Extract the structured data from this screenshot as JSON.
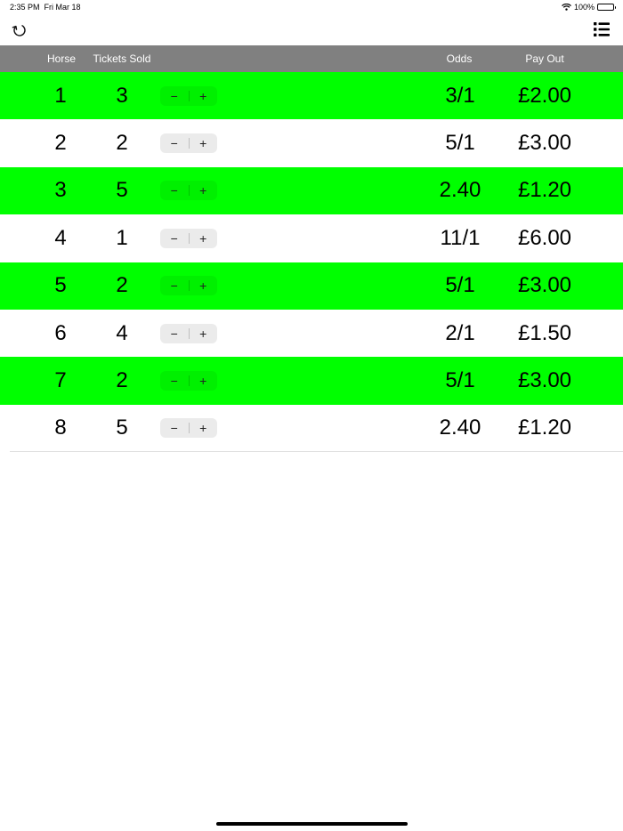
{
  "status_bar": {
    "time": "2:35 PM",
    "date": "Fri Mar 18",
    "battery_text": "100%",
    "wifi_icon": "wifi-icon",
    "battery_icon": "battery-icon"
  },
  "toolbar": {
    "refresh_icon": "refresh-icon",
    "list_icon": "list-icon"
  },
  "columns": {
    "horse": "Horse",
    "tickets_sold": "Tickets Sold",
    "odds": "Odds",
    "pay_out": "Pay Out"
  },
  "stepper": {
    "minus": "−",
    "plus": "+"
  },
  "colors": {
    "highlight": "#00ff00",
    "header_bg": "#808080",
    "plain_row": "#ffffff"
  },
  "rows": [
    {
      "horse": "1",
      "tickets": "3",
      "odds": "3/1",
      "payout": "£2.00",
      "highlight": true
    },
    {
      "horse": "2",
      "tickets": "2",
      "odds": "5/1",
      "payout": "£3.00",
      "highlight": false
    },
    {
      "horse": "3",
      "tickets": "5",
      "odds": "2.40",
      "payout": "£1.20",
      "highlight": true
    },
    {
      "horse": "4",
      "tickets": "1",
      "odds": "11/1",
      "payout": "£6.00",
      "highlight": false
    },
    {
      "horse": "5",
      "tickets": "2",
      "odds": "5/1",
      "payout": "£3.00",
      "highlight": true
    },
    {
      "horse": "6",
      "tickets": "4",
      "odds": "2/1",
      "payout": "£1.50",
      "highlight": false
    },
    {
      "horse": "7",
      "tickets": "2",
      "odds": "5/1",
      "payout": "£3.00",
      "highlight": true
    },
    {
      "horse": "8",
      "tickets": "5",
      "odds": "2.40",
      "payout": "£1.20",
      "highlight": false
    }
  ]
}
